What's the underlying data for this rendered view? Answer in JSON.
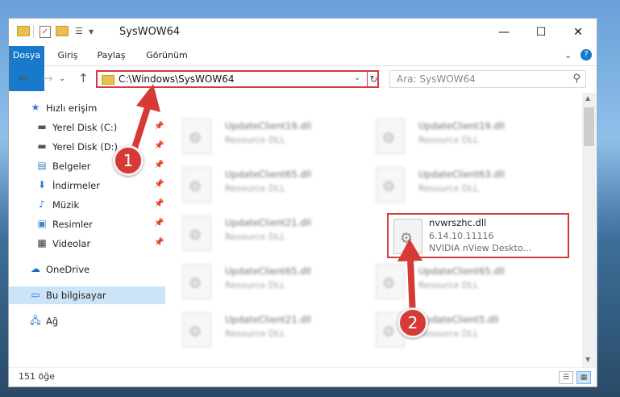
{
  "window": {
    "title": "SysWOW64"
  },
  "controls": {
    "minimize": "—",
    "maximize": "☐",
    "close": "✕"
  },
  "ribbon": {
    "tabs": [
      "Dosya",
      "Giriş",
      "Paylaş",
      "Görünüm"
    ],
    "help": "?"
  },
  "nav": {
    "back": "←",
    "forward": "→",
    "up": "↑"
  },
  "address": {
    "path": "C:\\Windows\\SysWOW64"
  },
  "search": {
    "placeholder": "Ara: SysWOW64"
  },
  "sidebar": {
    "quick_access": "Hızlı erişim",
    "items": [
      {
        "label": "Yerel Disk (C:)",
        "icon": "drive-icon"
      },
      {
        "label": "Yerel Disk (D:)",
        "icon": "drive-icon"
      },
      {
        "label": "Belgeler",
        "icon": "documents-icon"
      },
      {
        "label": "İndirmeler",
        "icon": "downloads-icon"
      },
      {
        "label": "Müzik",
        "icon": "music-icon"
      },
      {
        "label": "Resimler",
        "icon": "pictures-icon"
      },
      {
        "label": "Videolar",
        "icon": "videos-icon"
      }
    ],
    "onedrive": "OneDrive",
    "this_pc": "Bu bilgisayar",
    "network": "Ağ"
  },
  "files": [
    {
      "name": "UpdateClient19.dll",
      "desc": "Resource DLL"
    },
    {
      "name": "UpdateClient19.dll",
      "desc": "Resource DLL"
    },
    {
      "name": "UpdateClient65.dll",
      "desc": "Resource DLL"
    },
    {
      "name": "UpdateClient63.dll",
      "desc": "Resource DLL"
    },
    {
      "name": "UpdateClient21.dll",
      "desc": "Resource DLL"
    },
    {
      "name": "UpdateClient65.dll",
      "desc": "Resource DLL"
    },
    {
      "name": "UpdateClient65.dll",
      "desc": "Resource DLL"
    },
    {
      "name": "UpdateClient21.dll",
      "desc": "Resource DLL"
    },
    {
      "name": "UpdateClient5.dll",
      "desc": "Resource DLL"
    }
  ],
  "highlighted_file": {
    "name": "nvwrszhc.dll",
    "version": "6.14.10.11116",
    "desc": "NVIDIA nView Deskto..."
  },
  "status": {
    "count": "151 öğe"
  },
  "annotations": {
    "step1": "1",
    "step2": "2",
    "color": "#d53a36"
  }
}
